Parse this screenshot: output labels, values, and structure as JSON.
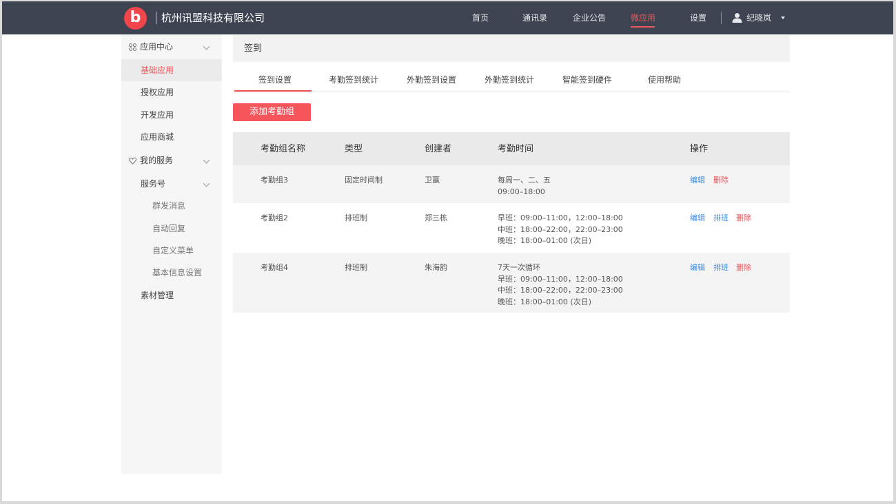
{
  "header": {
    "logo_letter": "b",
    "company": "杭州讯盟科技有限公司",
    "nav": [
      "首页",
      "通讯录",
      "企业公告",
      "微应用",
      "设置"
    ],
    "active_nav": "微应用",
    "user_name": "纪晓岚",
    "user_icon": "user-icon",
    "colors": {
      "bar": "#3d4350",
      "accent": "#f0555a"
    }
  },
  "sidebar": {
    "app_center": "应用中心",
    "basic_apps": "基础应用",
    "licensed_apps": "授权应用",
    "dev_apps": "开发应用",
    "app_store": "应用商城",
    "my_services": "我的服务",
    "service_account": "服务号",
    "mass_message": "群发消息",
    "auto_reply": "自动回复",
    "custom_menu": "自定义菜单",
    "basic_info": "基本信息设置",
    "materials": "素材管理",
    "icons": {
      "app_center": "apps-grid-icon",
      "my_services": "heart-icon"
    }
  },
  "main": {
    "page_title": "签到",
    "tabs": [
      "签到设置",
      "考勤签到统计",
      "外勤签到设置",
      "外勤签到统计",
      "智能签到硬件",
      "使用帮助"
    ],
    "active_tab": "签到设置",
    "add_button": "添加考勤组"
  },
  "table": {
    "headers": [
      "考勤组名称",
      "类型",
      "创建者",
      "考勤时间",
      "操作"
    ],
    "rows": [
      {
        "name": "考勤组3",
        "type": "固定时间制",
        "creator": "卫赢",
        "time": [
          "每周一、二、五",
          "09:00–18:00"
        ],
        "actions": [
          "编辑",
          "删除"
        ]
      },
      {
        "name": "考勤组2",
        "type": "排班制",
        "creator": "郑三栋",
        "time": [
          "早班：09:00–11:00，12:00–18:00",
          "中班：18:00–22:00，22:00–23:00",
          "晚班：18:00–01:00 (次日)"
        ],
        "actions": [
          "编辑",
          "排班",
          "删除"
        ]
      },
      {
        "name": "考勤组4",
        "type": "排班制",
        "creator": "朱海韵",
        "time": [
          "7天一次循环",
          "早班：09:00–11:00，12:00–18:00",
          "中班：18:00–22:00，22:00–23:00",
          "晚班：18:00–01:00 (次日)"
        ],
        "actions": [
          "编辑",
          "排班",
          "删除"
        ]
      }
    ]
  }
}
